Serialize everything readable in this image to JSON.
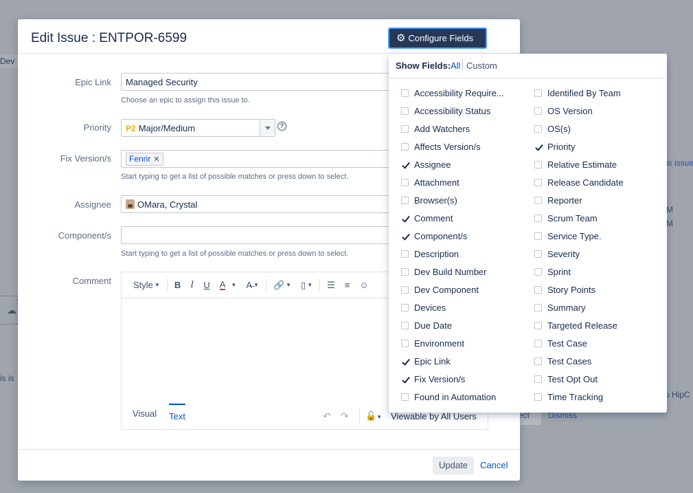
{
  "background": {
    "dev_chip": "Dev",
    "frag_issue": "is issue",
    "frag_m1": "M",
    "frag_m2": "M",
    "frag_isis": "is is",
    "frag_hipc": "o HipC",
    "frag_ect": "ect",
    "dismiss": "Dismiss"
  },
  "dialog": {
    "title": "Edit Issue : ENTPOR-6599",
    "configure_fields_label": "Configure Fields",
    "epic_link": {
      "label": "Epic Link",
      "value": "Managed Security",
      "hint": "Choose an epic to assign this issue to."
    },
    "priority": {
      "label": "Priority",
      "badge": "P2",
      "value": "Major/Medium"
    },
    "fix_versions": {
      "label": "Fix Version/s",
      "tag": "Fenrir",
      "hint": "Start typing to get a list of possible matches or press down to select."
    },
    "assignee": {
      "label": "Assignee",
      "value": "OMara, Crystal"
    },
    "components": {
      "label": "Component/s",
      "value": "",
      "hint": "Start typing to get a list of possible matches or press down to select."
    },
    "comment": {
      "label": "Comment",
      "toolbar": {
        "style": "Style",
        "bold": "B",
        "italic": "I",
        "underline": "U",
        "text_color": "A"
      },
      "tabs": {
        "visual": "Visual",
        "text": "Text"
      },
      "viewable": "Viewable by All Users"
    },
    "update_label": "Update",
    "cancel_label": "Cancel"
  },
  "field_config": {
    "show_fields_label": "Show Fields:",
    "all_label": "All",
    "custom_label": "Custom",
    "left_fields": [
      {
        "label": "Accessibility Require...",
        "checked": false
      },
      {
        "label": "Accessibility Status",
        "checked": false
      },
      {
        "label": "Add Watchers",
        "checked": false
      },
      {
        "label": "Affects Version/s",
        "checked": false
      },
      {
        "label": "Assignee",
        "checked": true
      },
      {
        "label": "Attachment",
        "checked": false
      },
      {
        "label": "Browser(s)",
        "checked": false
      },
      {
        "label": "Comment",
        "checked": true
      },
      {
        "label": "Component/s",
        "checked": true
      },
      {
        "label": "Description",
        "checked": false
      },
      {
        "label": "Dev Build Number",
        "checked": false
      },
      {
        "label": "Dev Component",
        "checked": false
      },
      {
        "label": "Devices",
        "checked": false
      },
      {
        "label": "Due Date",
        "checked": false
      },
      {
        "label": "Environment",
        "checked": false
      },
      {
        "label": "Epic Link",
        "checked": true
      },
      {
        "label": "Fix Version/s",
        "checked": true
      },
      {
        "label": "Found in Automation",
        "checked": false
      }
    ],
    "right_fields": [
      {
        "label": "Identified By Team",
        "checked": false
      },
      {
        "label": "OS Version",
        "checked": false
      },
      {
        "label": "OS(s)",
        "checked": false
      },
      {
        "label": "Priority",
        "checked": true
      },
      {
        "label": "Relative Estimate",
        "checked": false
      },
      {
        "label": "Release Candidate",
        "checked": false
      },
      {
        "label": "Reporter",
        "checked": false
      },
      {
        "label": "Scrum Team",
        "checked": false
      },
      {
        "label": "Service Type.",
        "checked": false
      },
      {
        "label": "Severity",
        "checked": false
      },
      {
        "label": "Sprint",
        "checked": false
      },
      {
        "label": "Story Points",
        "checked": false
      },
      {
        "label": "Summary",
        "checked": false
      },
      {
        "label": "Targeted Release",
        "checked": false
      },
      {
        "label": "Test Case",
        "checked": false
      },
      {
        "label": "Test Cases",
        "checked": false
      },
      {
        "label": "Test Opt Out",
        "checked": false
      },
      {
        "label": "Time Tracking",
        "checked": false
      }
    ]
  }
}
